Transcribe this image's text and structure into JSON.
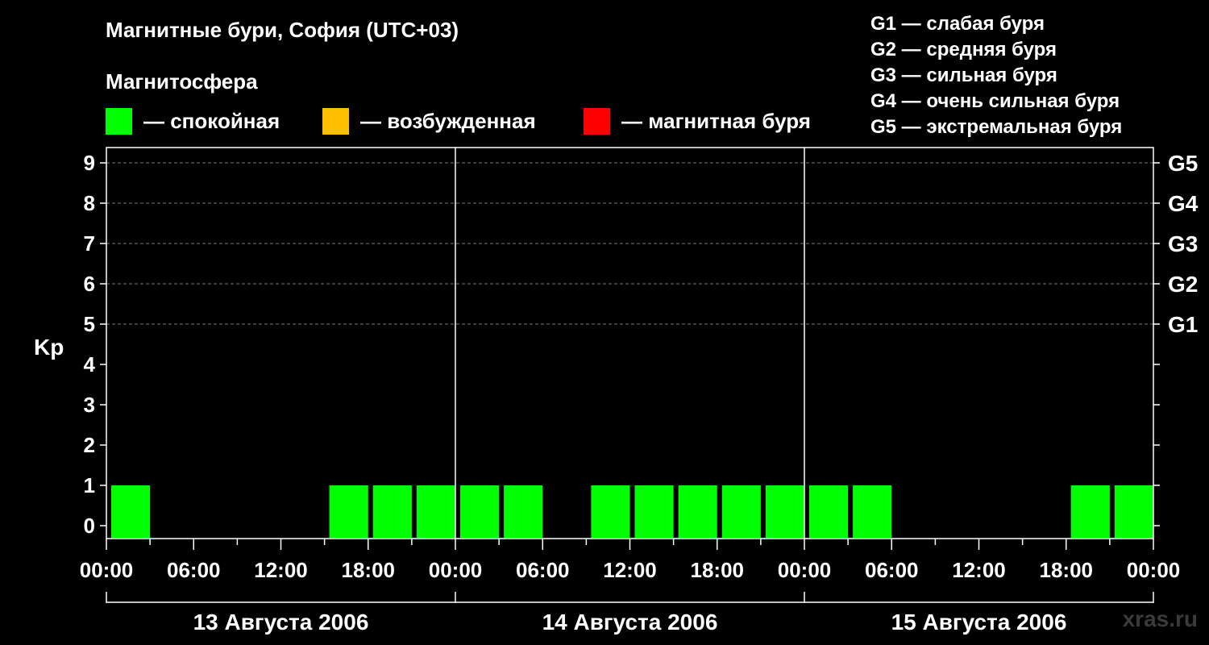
{
  "title": "Магнитные бури, София (UTC+03)",
  "magnetosphere_label": "Магнитосфера",
  "legend": [
    {
      "label": "— спокойная",
      "color": "#00ff00"
    },
    {
      "label": "— возбужденная",
      "color": "#ffbf00"
    },
    {
      "label": "— магнитная буря",
      "color": "#ff0000"
    }
  ],
  "g_scale": [
    "G1 — слабая буря",
    "G2 — средняя буря",
    "G3 — сильная буря",
    "G4 — очень сильная буря",
    "G5 — экстремальная буря"
  ],
  "watermark": "xras.ru",
  "chart_data": {
    "type": "bar",
    "ylabel": "Kp",
    "ylim": [
      0,
      9
    ],
    "yticks": [
      "0",
      "1",
      "2",
      "3",
      "4",
      "5",
      "6",
      "7",
      "8",
      "9"
    ],
    "right_labels": [
      {
        "kp": 5,
        "label": "G1"
      },
      {
        "kp": 6,
        "label": "G2"
      },
      {
        "kp": 7,
        "label": "G3"
      },
      {
        "kp": 8,
        "label": "G4"
      },
      {
        "kp": 9,
        "label": "G5"
      }
    ],
    "grid": "dashed horizontal at Kp 5-9",
    "xtick_labels": [
      "00:00",
      "06:00",
      "12:00",
      "18:00",
      "00:00",
      "06:00",
      "12:00",
      "18:00",
      "00:00",
      "06:00",
      "12:00",
      "18:00",
      "00:00"
    ],
    "days": [
      "13 Августа 2006",
      "14 Августа 2006",
      "15 Августа 2006"
    ],
    "interval_hours": 3,
    "categories": [
      "13 Авг 00:00",
      "13 Авг 03:00",
      "13 Авг 06:00",
      "13 Авг 09:00",
      "13 Авг 12:00",
      "13 Авг 15:00",
      "13 Авг 18:00",
      "13 Авг 21:00",
      "14 Авг 00:00",
      "14 Авг 03:00",
      "14 Авг 06:00",
      "14 Авг 09:00",
      "14 Авг 12:00",
      "14 Авг 15:00",
      "14 Авг 18:00",
      "14 Авг 21:00",
      "15 Авг 00:00",
      "15 Авг 03:00",
      "15 Авг 06:00",
      "15 Авг 09:00",
      "15 Авг 12:00",
      "15 Авг 15:00",
      "15 Авг 18:00",
      "15 Авг 21:00"
    ],
    "values": [
      1,
      0,
      0,
      0,
      0,
      1,
      1,
      1,
      1,
      1,
      0,
      1,
      1,
      1,
      1,
      1,
      1,
      1,
      0,
      0,
      0,
      0,
      1,
      1
    ],
    "series_color": "#00ff00"
  }
}
